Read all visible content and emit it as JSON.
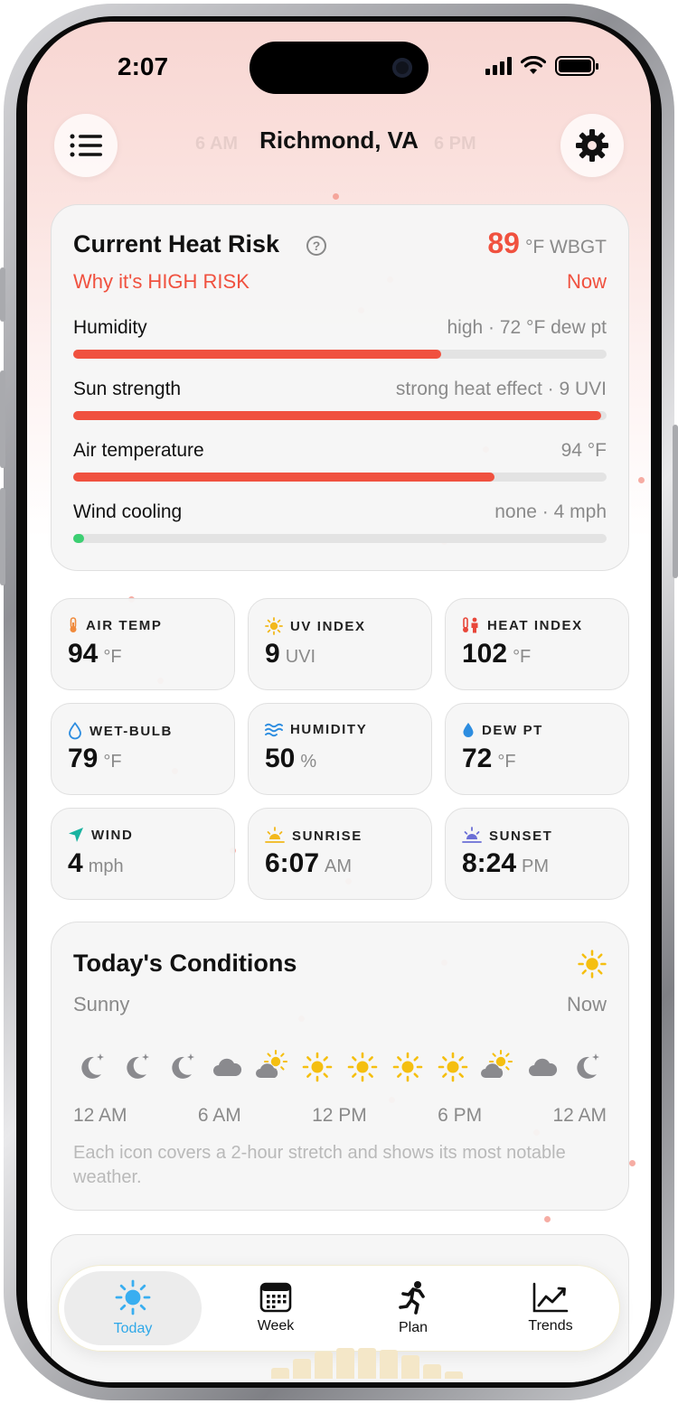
{
  "status": {
    "time": "2:07"
  },
  "header": {
    "city": "Richmond, VA",
    "ghost_times": [
      "6 AM",
      "6 PM"
    ]
  },
  "heat_risk": {
    "title": "Current Heat Risk",
    "value": "89",
    "unit": "°F WBGT",
    "why": "Why it's HIGH RISK",
    "when": "Now",
    "accent": "#f0513f",
    "factors": [
      {
        "label": "Humidity",
        "value": "high · 72 °F dew pt",
        "level": 0.69,
        "color": "#f0513f"
      },
      {
        "label": "Sun strength",
        "value": "strong heat effect · 9 UVI",
        "level": 0.99,
        "color": "#f0513f"
      },
      {
        "label": "Air temperature",
        "value": "94 °F",
        "level": 0.79,
        "color": "#f0513f"
      },
      {
        "label": "Wind cooling",
        "value": "none · 4 mph",
        "level": 0.02,
        "color": "#3ccf72"
      }
    ]
  },
  "metrics": [
    {
      "label": "AIR TEMP",
      "value": "94",
      "unit": "°F",
      "icon": "thermometer-icon"
    },
    {
      "label": "UV INDEX",
      "value": "9",
      "unit": "UVI",
      "icon": "sun-icon"
    },
    {
      "label": "HEAT INDEX",
      "value": "102",
      "unit": "°F",
      "icon": "heat-person-icon"
    },
    {
      "label": "WET-BULB",
      "value": "79",
      "unit": "°F",
      "icon": "drop-outline-icon"
    },
    {
      "label": "HUMIDITY",
      "value": "50",
      "unit": "%",
      "icon": "humidity-waves-icon"
    },
    {
      "label": "DEW PT",
      "value": "72",
      "unit": "°F",
      "icon": "drop-icon"
    },
    {
      "label": "WIND",
      "value": "4",
      "unit": "mph",
      "icon": "wind-arrow-icon"
    },
    {
      "label": "SUNRISE",
      "value": "6:07",
      "unit": "AM",
      "icon": "sunrise-icon"
    },
    {
      "label": "SUNSET",
      "value": "8:24",
      "unit": "PM",
      "icon": "sunset-icon"
    }
  ],
  "conditions": {
    "title": "Today's Conditions",
    "summary": "Sunny",
    "when": "Now",
    "hourly_icons": [
      "moon-star",
      "moon-star",
      "moon-star",
      "cloud",
      "partly-sunny",
      "sun",
      "sun",
      "sun",
      "sun",
      "partly-sunny",
      "cloud",
      "moon-star"
    ],
    "time_labels": [
      "12 AM",
      "6 AM",
      "12 PM",
      "6 PM",
      "12 AM"
    ],
    "note": "Each icon covers a 2-hour stretch and shows its most notable weather."
  },
  "tabs": [
    {
      "label": "Today",
      "icon": "sun-icon",
      "active": true
    },
    {
      "label": "Week",
      "icon": "calendar-icon",
      "active": false
    },
    {
      "label": "Plan",
      "icon": "runner-icon",
      "active": false
    },
    {
      "label": "Trends",
      "icon": "trend-chart-icon",
      "active": false
    }
  ]
}
